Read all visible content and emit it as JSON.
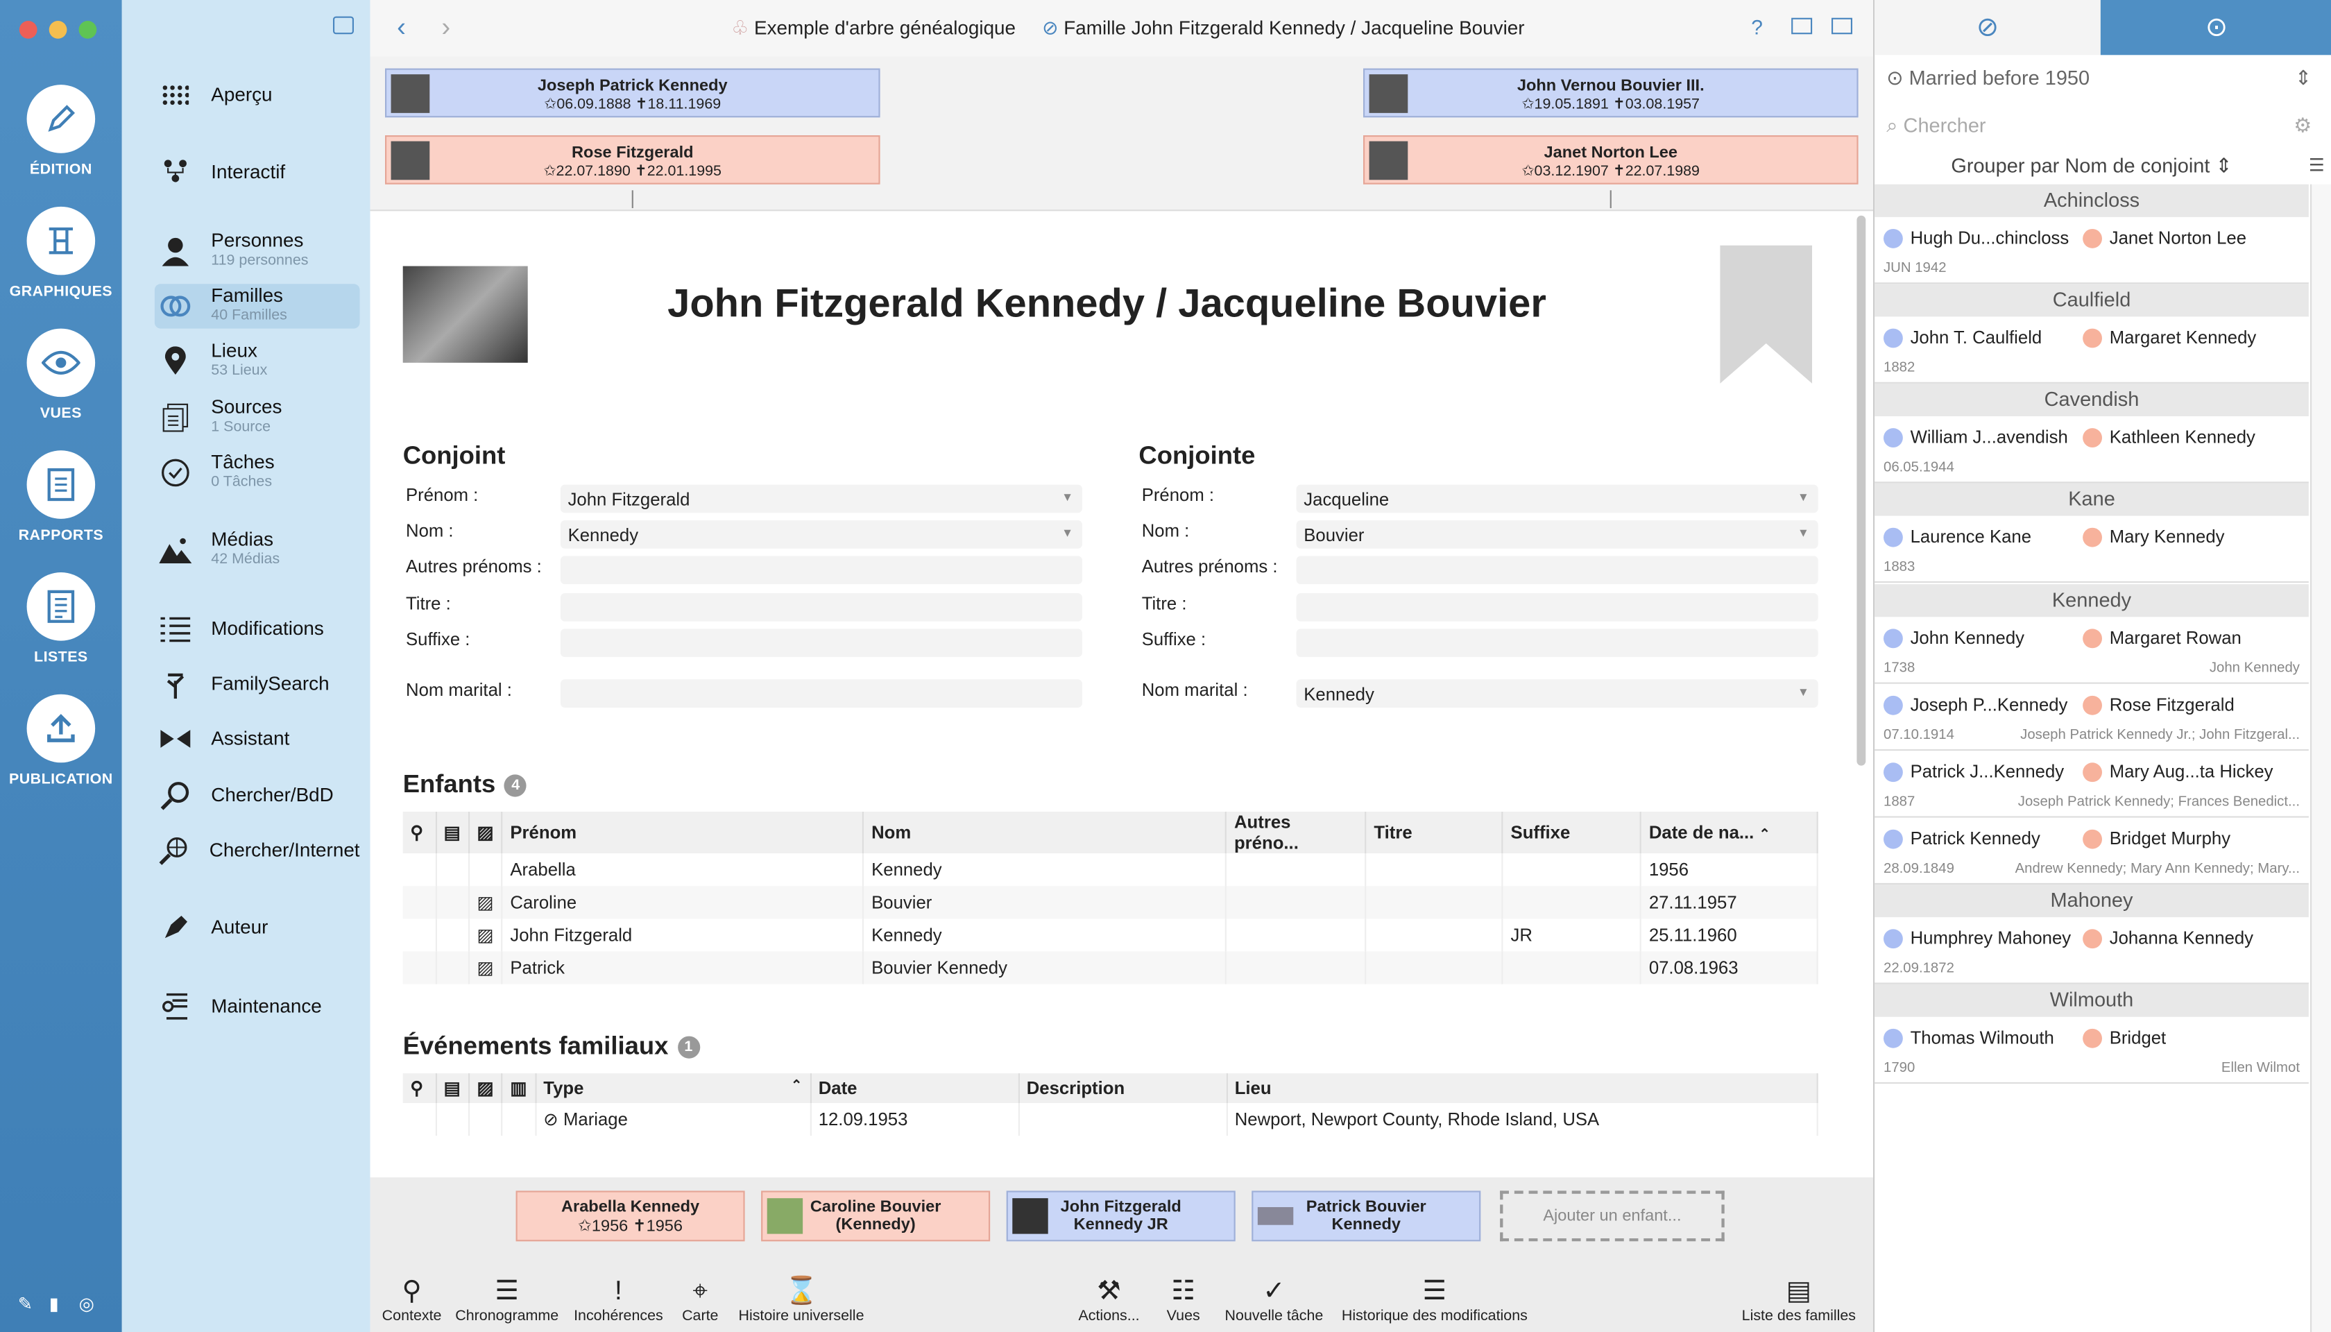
{
  "window": {
    "tree_name": "Exemple d'arbre généalogique",
    "family_title": "Famille John Fitzgerald Kennedy / Jacqueline Bouvier"
  },
  "rail": [
    {
      "label": "ÉDITION"
    },
    {
      "label": "GRAPHIQUES"
    },
    {
      "label": "VUES"
    },
    {
      "label": "RAPPORTS"
    },
    {
      "label": "LISTES"
    },
    {
      "label": "PUBLICATION"
    }
  ],
  "sidebar": {
    "items": [
      {
        "label": "Aperçu",
        "sub": ""
      },
      {
        "label": "Interactif",
        "sub": ""
      },
      {
        "label": "Personnes",
        "sub": "119 personnes"
      },
      {
        "label": "Familles",
        "sub": "40 Familles"
      },
      {
        "label": "Lieux",
        "sub": "53 Lieux"
      },
      {
        "label": "Sources",
        "sub": "1 Source"
      },
      {
        "label": "Tâches",
        "sub": "0 Tâches"
      },
      {
        "label": "Médias",
        "sub": "42 Médias"
      },
      {
        "label": "Modifications",
        "sub": ""
      },
      {
        "label": "FamilySearch",
        "sub": ""
      },
      {
        "label": "Assistant",
        "sub": ""
      },
      {
        "label": "Chercher/BdD",
        "sub": ""
      },
      {
        "label": "Chercher/Internet",
        "sub": ""
      },
      {
        "label": "Auteur",
        "sub": ""
      },
      {
        "label": "Maintenance",
        "sub": ""
      }
    ]
  },
  "parents": {
    "h_father": {
      "name": "Joseph Patrick Kennedy",
      "dates": "✩06.09.1888  ✝18.11.1969"
    },
    "h_mother": {
      "name": "Rose Fitzgerald",
      "dates": "✩22.07.1890  ✝22.01.1995"
    },
    "w_father": {
      "name": "John Vernou Bouvier III.",
      "dates": "✩19.05.1891  ✝03.08.1957"
    },
    "w_mother": {
      "name": "Janet Norton Lee",
      "dates": "✩03.12.1907  ✝22.07.1989"
    }
  },
  "family": {
    "title": "John Fitzgerald Kennedy / Jacqueline Bouvier"
  },
  "husband": {
    "heading": "Conjoint",
    "labels": {
      "first": "Prénom :",
      "last": "Nom :",
      "other": "Autres prénoms :",
      "title": "Titre :",
      "suffix": "Suffixe :",
      "married": "Nom marital :"
    },
    "first": "John Fitzgerald",
    "last": "Kennedy",
    "other": "",
    "title": "",
    "suffix": "",
    "married": ""
  },
  "wife": {
    "heading": "Conjointe",
    "labels": {
      "first": "Prénom :",
      "last": "Nom :",
      "other": "Autres prénoms :",
      "title": "Titre :",
      "suffix": "Suffixe :",
      "married": "Nom marital :"
    },
    "first": "Jacqueline",
    "last": "Bouvier",
    "other": "",
    "title": "",
    "suffix": "",
    "married": "Kennedy"
  },
  "children": {
    "heading": "Enfants",
    "count": "4",
    "columns": [
      "Prénom",
      "Nom",
      "Autres préno...",
      "Titre",
      "Suffixe",
      "Date de na..."
    ],
    "rows": [
      {
        "first": "Arabella",
        "last": "Kennedy",
        "other": "",
        "title": "",
        "suffix": "",
        "date": "1956"
      },
      {
        "first": "Caroline",
        "last": "Bouvier",
        "other": "",
        "title": "",
        "suffix": "",
        "date": "27.11.1957"
      },
      {
        "first": "John Fitzgerald",
        "last": "Kennedy",
        "other": "",
        "title": "",
        "suffix": "JR",
        "date": "25.11.1960"
      },
      {
        "first": "Patrick",
        "last": "Bouvier Kennedy",
        "other": "",
        "title": "",
        "suffix": "",
        "date": "07.08.1963"
      }
    ]
  },
  "events": {
    "heading": "Événements familiaux",
    "count": "1",
    "columns": [
      "Type",
      "Date",
      "Description",
      "Lieu"
    ],
    "rows": [
      {
        "type": "Mariage",
        "date": "12.09.1953",
        "description": "",
        "place": "Newport, Newport County, Rhode Island, USA"
      }
    ]
  },
  "kid_boxes": [
    {
      "name": "Arabella Kennedy",
      "sub": "✩1956  ✝1956"
    },
    {
      "name": "Caroline Bouvier",
      "sub": "(Kennedy)"
    },
    {
      "name": "John Fitzgerald",
      "sub": "Kennedy JR"
    },
    {
      "name": "Patrick Bouvier",
      "sub": "Kennedy"
    }
  ],
  "add_child": "Ajouter un enfant...",
  "toolbar": {
    "left": [
      "Contexte",
      "Chronogramme",
      "Incohérences",
      "Carte",
      "Histoire universelle"
    ],
    "center": [
      "Actions...",
      "Vues",
      "Nouvelle tâche",
      "Historique des modifications"
    ],
    "right": "Liste des familles"
  },
  "right_panel": {
    "filter": "Married before 1950",
    "search_placeholder": "Chercher",
    "group_by": "Grouper par Nom de conjoint",
    "groups": [
      {
        "name": "Achincloss",
        "rows": [
          {
            "m": "Hugh Du...chincloss",
            "f": "Janet Norton Lee",
            "date": "JUN 1942",
            "kids": ""
          }
        ]
      },
      {
        "name": "Caulfield",
        "rows": [
          {
            "m": "John T. Caulfield",
            "f": "Margaret Kennedy",
            "date": "1882",
            "kids": ""
          }
        ]
      },
      {
        "name": "Cavendish",
        "rows": [
          {
            "m": "William J...avendish",
            "f": "Kathleen Kennedy",
            "date": "06.05.1944",
            "kids": ""
          }
        ]
      },
      {
        "name": "Kane",
        "rows": [
          {
            "m": "Laurence Kane",
            "f": "Mary Kennedy",
            "date": "1883",
            "kids": ""
          }
        ]
      },
      {
        "name": "Kennedy",
        "rows": [
          {
            "m": "John Kennedy",
            "f": "Margaret Rowan",
            "date": "1738",
            "kids": "John Kennedy"
          },
          {
            "m": "Joseph P...Kennedy",
            "f": "Rose Fitzgerald",
            "date": "07.10.1914",
            "kids": "Joseph Patrick Kennedy Jr.; John Fitzgeral..."
          },
          {
            "m": "Patrick J...Kennedy",
            "f": "Mary Aug...ta Hickey",
            "date": "1887",
            "kids": "Joseph Patrick Kennedy; Frances Benedict..."
          },
          {
            "m": "Patrick Kennedy",
            "f": "Bridget Murphy",
            "date": "28.09.1849",
            "kids": "Andrew Kennedy; Mary Ann Kennedy; Mary..."
          }
        ]
      },
      {
        "name": "Mahoney",
        "rows": [
          {
            "m": "Humphrey Mahoney",
            "f": "Johanna Kennedy",
            "date": "22.09.1872",
            "kids": ""
          }
        ]
      },
      {
        "name": "Wilmouth",
        "rows": [
          {
            "m": "Thomas Wilmouth",
            "f": "Bridget",
            "date": "1790",
            "kids": "Ellen Wilmot"
          }
        ]
      }
    ]
  }
}
